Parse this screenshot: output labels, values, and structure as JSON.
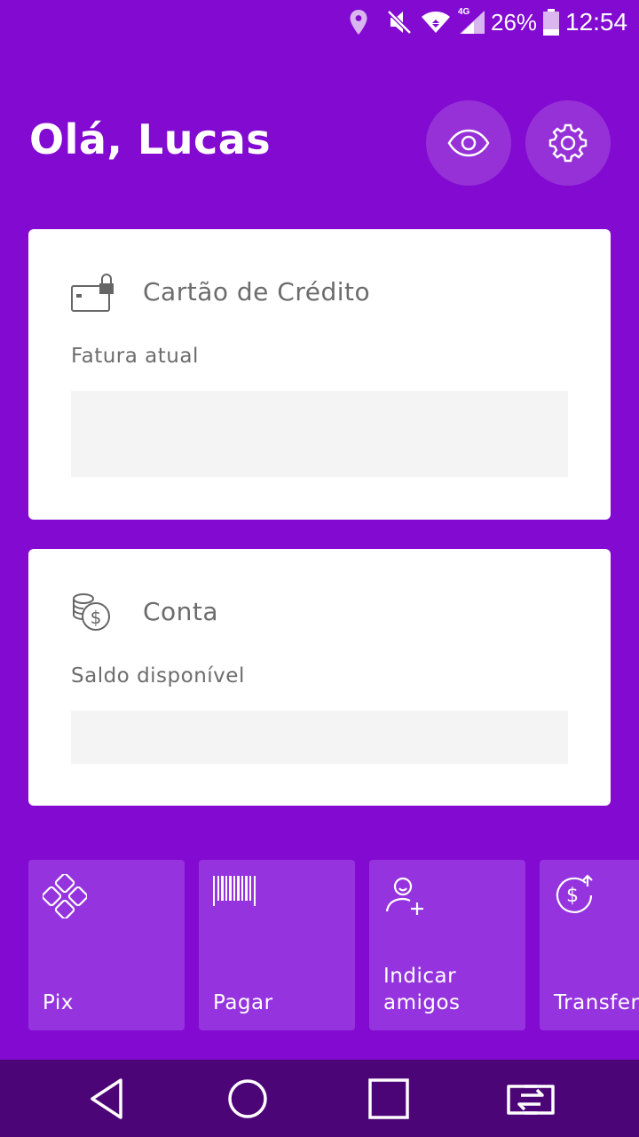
{
  "status_bar": {
    "battery_percent": "26%",
    "time": "12:54",
    "network_label": "4G",
    "icons": [
      "location-icon",
      "mute-icon",
      "wifi-icon",
      "signal-icon",
      "battery-icon"
    ]
  },
  "header": {
    "greeting": "Olá, Lucas",
    "buttons": [
      "eye-icon",
      "gear-icon"
    ]
  },
  "credit_card": {
    "title": "Cartão de Crédito",
    "subtitle": "Fatura atual",
    "icon": "credit-card-lock-icon"
  },
  "account": {
    "title": "Conta",
    "subtitle": "Saldo disponível",
    "icon": "coins-icon"
  },
  "shortcuts": [
    {
      "label": "Pix",
      "icon": "pix-icon"
    },
    {
      "label": "Pagar",
      "icon": "barcode-icon"
    },
    {
      "label": "Indicar\namigos",
      "icon": "add-friend-icon"
    },
    {
      "label": "Transferir",
      "icon": "transfer-money-icon"
    }
  ],
  "nav_bar": {
    "icons": [
      "back-icon",
      "home-icon",
      "recents-icon",
      "switch-app-icon"
    ]
  },
  "colors": {
    "background": "#820ad1",
    "tile": "#9534de",
    "nav_bar": "#4c0577",
    "card": "#ffffff",
    "placeholder": "#f4f4f4",
    "text_gray": "#6c6c6c"
  }
}
